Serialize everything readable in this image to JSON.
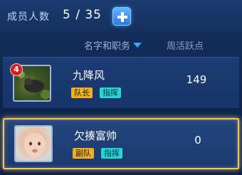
{
  "header": {
    "member_label": "成员人数",
    "member_count": "5 / 35",
    "add_icon": "plus-icon"
  },
  "columns": {
    "name_role": "名字和职务",
    "weekly_activity": "周活跃点"
  },
  "members": [
    {
      "level": "4",
      "name": "九降风",
      "role_tag": "队长",
      "command_tag": "指挥",
      "activity": "149"
    },
    {
      "name": "欠揍富帅",
      "role_tag": "副队",
      "command_tag": "指挥",
      "activity": "0"
    }
  ],
  "colors": {
    "accent": "#3aa6ff",
    "selected_border": "#e9c76a",
    "role_tag": "#f2b01f",
    "command_tag": "#26d6d6"
  }
}
